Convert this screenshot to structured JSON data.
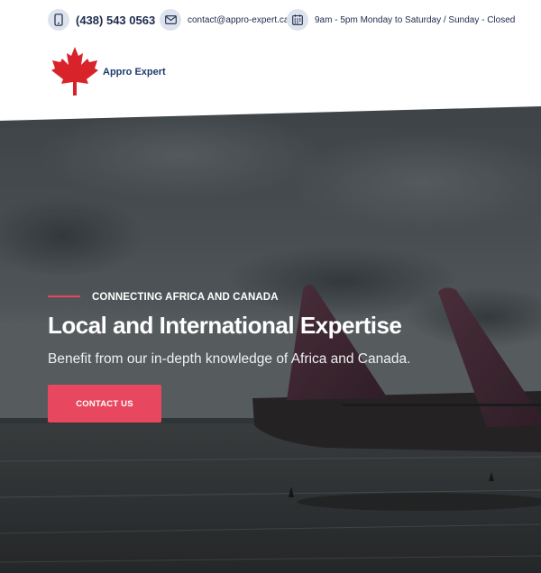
{
  "contact_bar": {
    "phone": {
      "icon": "phone-icon",
      "text": "(438) 543 0563"
    },
    "email": {
      "icon": "envelope-icon",
      "text": "contact@appro-expert.ca"
    },
    "hours": {
      "icon": "calendar-icon",
      "text": "9am - 5pm Monday to Saturday / Sunday - Closed"
    }
  },
  "logo": {
    "icon": "maple-leaf-icon",
    "brand_name": "Appro Expert"
  },
  "hero": {
    "eyebrow": "CONNECTING AFRICA AND CANADA",
    "title": "Local and International Expertise",
    "subtitle": "Benefit from our in-depth knowledge of Africa and Canada.",
    "cta_label": "CONTACT US"
  },
  "colors": {
    "accent": "#e8485f",
    "navy": "#1d2a4d",
    "icon_bg": "#dde3ec",
    "maple_red": "#d8232a"
  }
}
